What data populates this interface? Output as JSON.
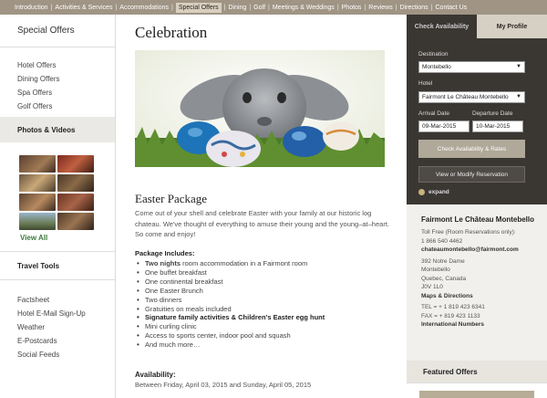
{
  "topnav": {
    "items": [
      "Introduction",
      "Activities & Services",
      "Accommodations",
      "Special Offers",
      "Dining",
      "Golf",
      "Meetings & Weddings",
      "Photos",
      "Reviews",
      "Directions",
      "Contact Us"
    ],
    "active_index": 3
  },
  "left": {
    "section_title": "Special Offers",
    "offer_links": [
      "Hotel Offers",
      "Dining Offers",
      "Spa Offers",
      "Golf Offers"
    ],
    "photos_title": "Photos & Videos",
    "view_all": "View All",
    "travel_title": "Travel Tools",
    "travel_links": [
      "Factsheet",
      "Hotel E-Mail Sign-Up",
      "Weather",
      "E-Postcards",
      "Social Feeds"
    ]
  },
  "main": {
    "title": "Celebration",
    "package_title": "Easter Package",
    "intro": "Come out of your shell and celebrate Easter with your family at our historic log chateau. We've thought of everything to amuse their young and the young–at–heart. So come and enjoy!",
    "includes_label": "Package Includes:",
    "includes": [
      {
        "bold": "Two nights",
        "text": " room accommodation in a Fairmont room"
      },
      {
        "bold": "",
        "text": "One buffet breakfast"
      },
      {
        "bold": "",
        "text": "One continental breakfast"
      },
      {
        "bold": "",
        "text": "One Easter Brunch"
      },
      {
        "bold": "",
        "text": "Two dinners"
      },
      {
        "bold": "",
        "text": "Gratuities on meals included"
      },
      {
        "bold": "Signature family activities & Children's Easter egg hunt",
        "text": ""
      },
      {
        "bold": "",
        "text": "Mini curling clinic"
      },
      {
        "bold": "",
        "text": "Access to sports center, indoor pool and squash"
      },
      {
        "bold": "",
        "text": "And much more…"
      }
    ],
    "availability_label": "Availability:",
    "availability_text": "Between Friday, April 03, 2015 and Sunday, April 05, 2015"
  },
  "booking": {
    "tab_check": "Check Availability",
    "tab_profile": "My Profile",
    "destination_label": "Destination",
    "destination_value": "Montebello",
    "hotel_label": "Hotel",
    "hotel_value": "Fairmont Le Château Montebello",
    "arrival_label": "Arrival Date",
    "arrival_value": "09-Mar-2015",
    "departure_label": "Departure Date",
    "departure_value": "10-Mar-2015",
    "check_button": "Check Availability & Rates",
    "modify_button": "View or Modify Reservation",
    "expand": "expand"
  },
  "contact": {
    "hotel_name": "Fairmont Le Château Montebello",
    "toll_free": "Toll Free (Room Reservations only):",
    "toll_free_number": "1 866 540 4462",
    "email": "chateaumontebello@fairmont.com",
    "address": [
      "392 Notre Dame",
      "Montebello",
      "Quebec, Canada",
      "J0V 1L0"
    ],
    "maps": "Maps & Directions",
    "tel": "TEL = + 1 819 423 6341",
    "fax": "FAX = + 819 423 1133",
    "intl": "International Numbers"
  },
  "featured": {
    "title": "Featured Offers"
  },
  "colors": {
    "nav_bg": "#a09484",
    "booking_bg": "#3a3632",
    "link_green": "#3c7a3c"
  }
}
